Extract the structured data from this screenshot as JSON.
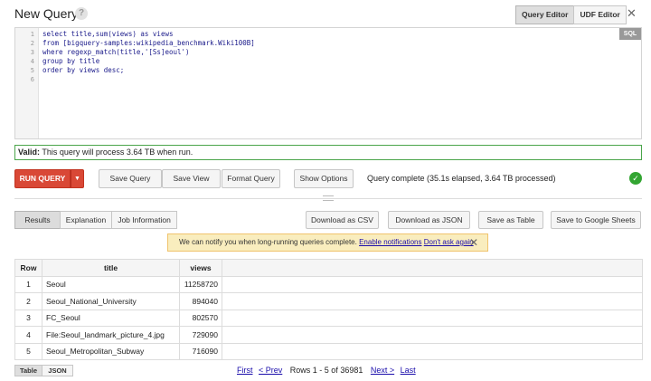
{
  "header": {
    "title": "New Query",
    "help": "?",
    "tabs": [
      "Query Editor",
      "UDF Editor"
    ],
    "close": "✕"
  },
  "editor": {
    "badge": "SQL",
    "line_numbers": [
      "1",
      "2",
      "3",
      "4",
      "5",
      "6"
    ],
    "lines": [
      "select title,sum(views) as views",
      "from [bigquery-samples:wikipedia_benchmark.Wiki100B]",
      "where regexp_match(title,'[Ss]eoul')",
      "group by title",
      "order by views desc;",
      ""
    ]
  },
  "validation": {
    "label": "Valid:",
    "message": "This query will process 3.64 TB when run."
  },
  "actions": {
    "run": "RUN QUERY",
    "run_caret": "▼",
    "save_query": "Save Query",
    "save_view": "Save View",
    "format_query": "Format Query",
    "show_options": "Show Options",
    "status": "Query complete (35.1s elapsed, 3.64 TB processed)",
    "status_icon": "✓"
  },
  "results_tabs": [
    "Results",
    "Explanation",
    "Job Information"
  ],
  "downloads": [
    "Download as CSV",
    "Download as JSON",
    "Save as Table",
    "Save to Google Sheets"
  ],
  "notification": {
    "text": "We can notify you when long-running queries complete.",
    "enable_link": "Enable notifications",
    "dismiss_link": "Don't ask again",
    "close": "✕"
  },
  "table": {
    "headers": [
      "Row",
      "title",
      "views"
    ],
    "rows": [
      [
        "1",
        "Seoul",
        "11258720"
      ],
      [
        "2",
        "Seoul_National_University",
        "894040"
      ],
      [
        "3",
        "FC_Seoul",
        "802570"
      ],
      [
        "4",
        "File:Seoul_landmark_picture_4.jpg",
        "729090"
      ],
      [
        "5",
        "Seoul_Metropolitan_Subway",
        "716090"
      ]
    ]
  },
  "view_tabs": [
    "Table",
    "JSON"
  ],
  "pager": {
    "first": "First",
    "prev": "< Prev",
    "rows": "Rows 1 - 5 of 36981",
    "next": "Next >",
    "last": "Last"
  },
  "colors": {
    "run_button": "#d94836",
    "valid_border": "#4aa54a",
    "success": "#33a532",
    "notification_bg": "#f9edbe"
  }
}
